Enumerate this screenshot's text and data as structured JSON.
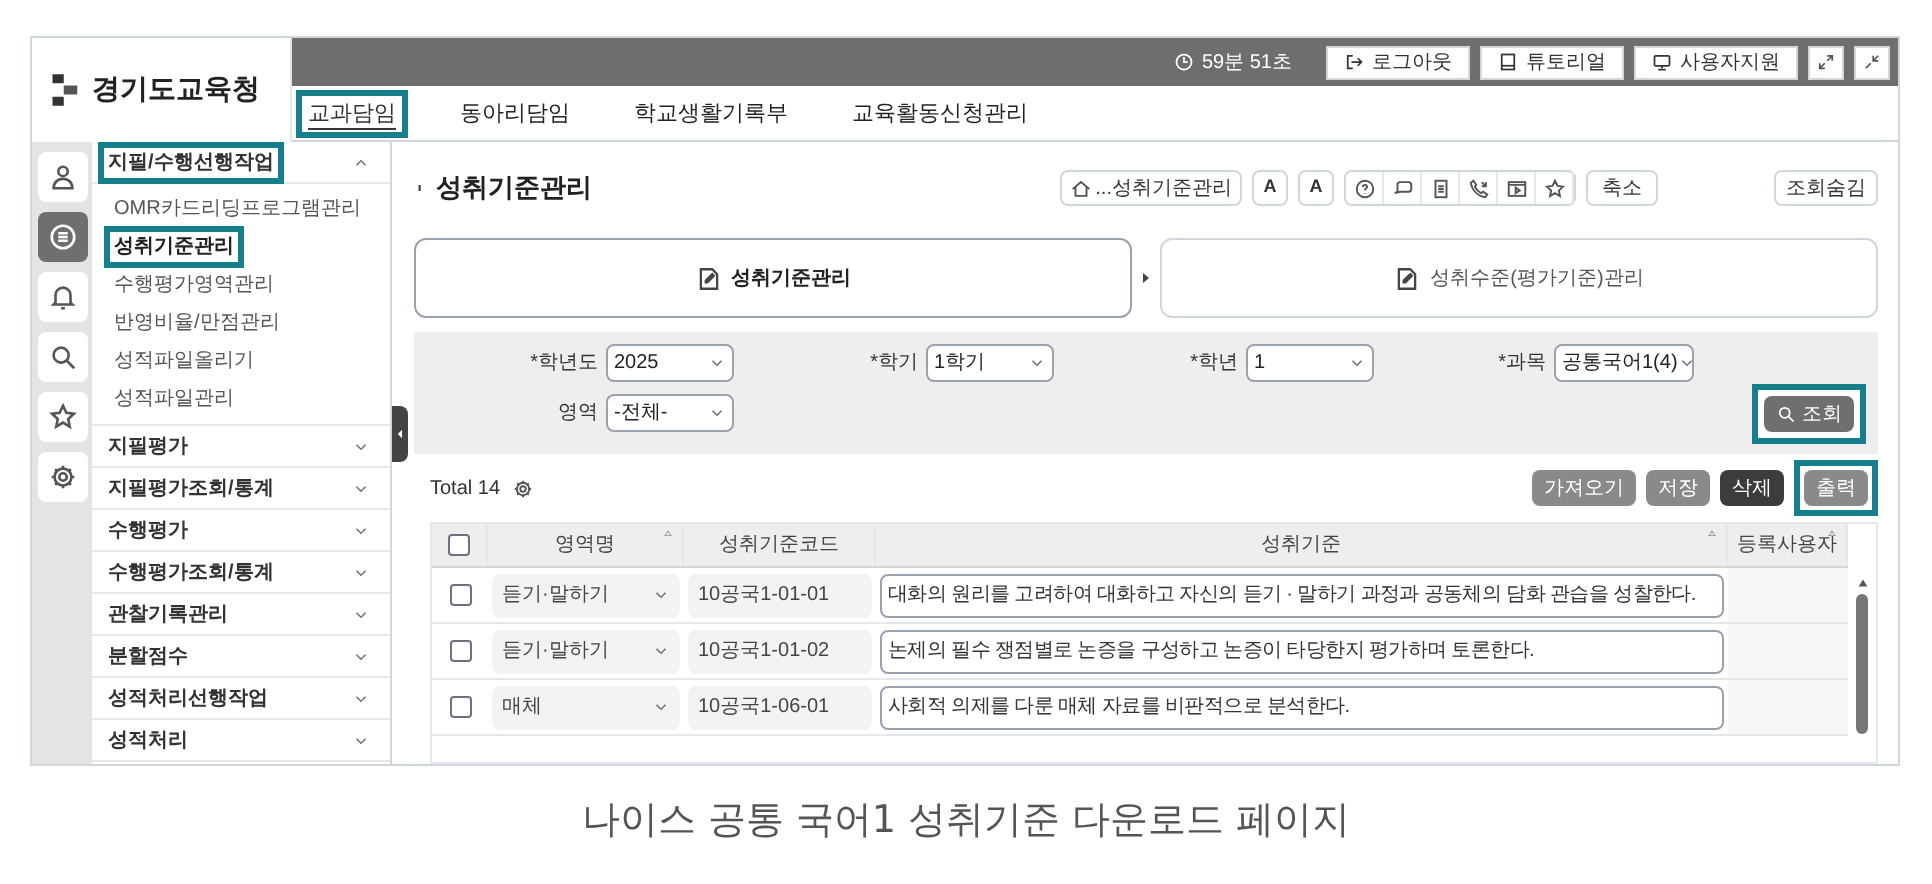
{
  "header": {
    "logo_title": "경기도교육청",
    "timer": "59분 51초",
    "buttons": [
      {
        "label": "로그아웃"
      },
      {
        "label": "튜토리얼"
      },
      {
        "label": "사용자지원"
      }
    ]
  },
  "nav_tabs": [
    {
      "label": "교과담임",
      "selected": true,
      "highlighted": true
    },
    {
      "label": "동아리담임",
      "selected": false,
      "highlighted": false
    },
    {
      "label": "학교생활기록부",
      "selected": false,
      "highlighted": false
    },
    {
      "label": "교육활동신청관리",
      "selected": false,
      "highlighted": false
    }
  ],
  "icon_rail": [
    {
      "selected": false
    },
    {
      "selected": true
    },
    {
      "selected": false
    },
    {
      "selected": false
    },
    {
      "selected": false
    },
    {
      "selected": false
    }
  ],
  "sidebar": {
    "groups": [
      {
        "label": "지필/수행선행작업",
        "expanded": true,
        "highlighted": true,
        "children": [
          {
            "label": "OMR카드리딩프로그램관리",
            "highlighted": false,
            "selected": false
          },
          {
            "label": "성취기준관리",
            "highlighted": true,
            "selected": true
          },
          {
            "label": "수행평가영역관리",
            "highlighted": false,
            "selected": false
          },
          {
            "label": "반영비율/만점관리",
            "highlighted": false,
            "selected": false
          },
          {
            "label": "성적파일올리기",
            "highlighted": false,
            "selected": false
          },
          {
            "label": "성적파일관리",
            "highlighted": false,
            "selected": false
          }
        ]
      },
      {
        "label": "지필평가",
        "expanded": false,
        "highlighted": false
      },
      {
        "label": "지필평가조회/통계",
        "expanded": false,
        "highlighted": false
      },
      {
        "label": "수행평가",
        "expanded": false,
        "highlighted": false
      },
      {
        "label": "수행평가조회/통계",
        "expanded": false,
        "highlighted": false
      },
      {
        "label": "관찰기록관리",
        "expanded": false,
        "highlighted": false
      },
      {
        "label": "분할점수",
        "expanded": false,
        "highlighted": false
      },
      {
        "label": "성적처리선행작업",
        "expanded": false,
        "highlighted": false
      },
      {
        "label": "성적처리",
        "expanded": false,
        "highlighted": false
      }
    ]
  },
  "page_title": "성취기준관리",
  "toolbar": {
    "breadcrumb": "...성취기준관리",
    "font_buttons": [
      "A",
      "A"
    ],
    "shrink": "축소",
    "hide_search": "조회숨김"
  },
  "steps": [
    {
      "label": "성취기준관리",
      "selected": true
    },
    {
      "label": "성취수준(평가기준)관리",
      "selected": false
    }
  ],
  "filters": [
    {
      "label": "*학년도",
      "value": "2025"
    },
    {
      "label": "*학기",
      "value": "1학기"
    },
    {
      "label": "*학년",
      "value": "1"
    },
    {
      "label": "*과목",
      "value": "공통국어1(4)"
    },
    {
      "label": "영역",
      "value": "-전체-"
    }
  ],
  "search_button": {
    "label": "조회",
    "highlighted": true
  },
  "total": "Total 14",
  "actions": [
    {
      "label": "가져오기",
      "kind": "gray",
      "highlighted": false
    },
    {
      "label": "저장",
      "kind": "gray",
      "highlighted": false
    },
    {
      "label": "삭제",
      "kind": "dark",
      "highlighted": false
    },
    {
      "label": "출력",
      "kind": "gray",
      "highlighted": true
    }
  ],
  "table": {
    "header_checked": false,
    "columns": [
      {
        "label": "영역명",
        "sortable": true
      },
      {
        "label": "성취기준코드",
        "sortable": false
      },
      {
        "label": "성취기준",
        "sortable": true
      },
      {
        "label": "등록사용자",
        "sortable": true
      }
    ],
    "rows": [
      {
        "checked": false,
        "area": "듣기·말하기",
        "code": "10공국1-01-01",
        "standard": "대화의 원리를 고려하여 대화하고 자신의 듣기 · 말하기 과정과 공동체의 담화 관습을 성찰한다."
      },
      {
        "checked": false,
        "area": "듣기·말하기",
        "code": "10공국1-01-02",
        "standard": "논제의 필수 쟁점별로 논증을 구성하고 논증이 타당한지 평가하며 토론한다."
      },
      {
        "checked": false,
        "area": "매체",
        "code": "10공국1-06-01",
        "standard": "사회적 의제를 다룬 매체 자료를 비판적으로 분석한다."
      }
    ]
  },
  "caption": "나이스 공통 국어1 성취기준 다운로드 페이지"
}
